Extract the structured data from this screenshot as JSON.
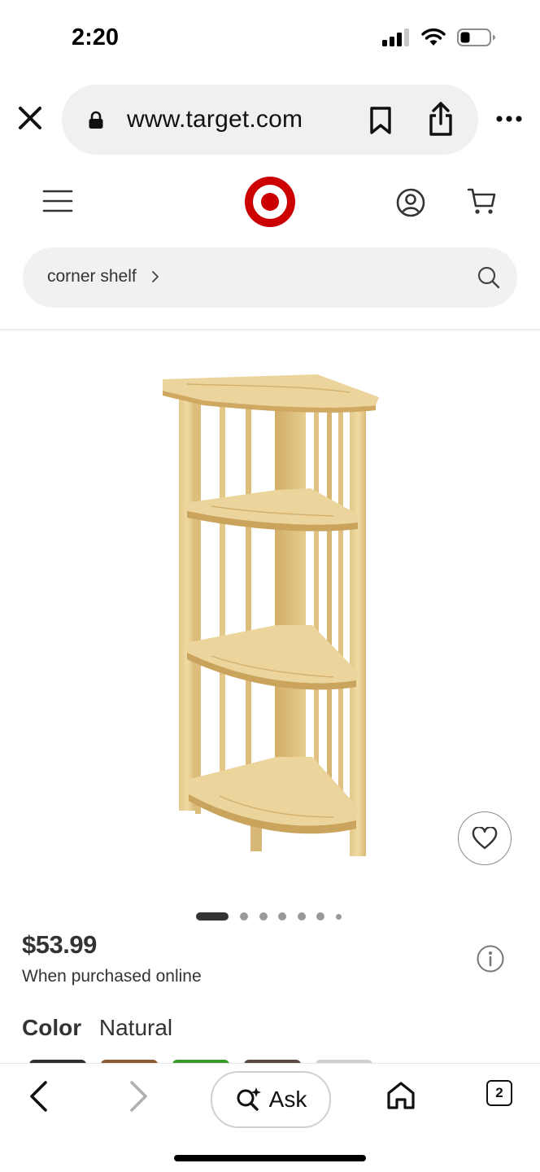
{
  "status": {
    "time": "2:20"
  },
  "browser": {
    "url": "www.target.com",
    "icons": [
      "close-icon",
      "lock-icon",
      "bookmark-icon",
      "share-icon",
      "more-icon"
    ]
  },
  "header": {
    "icons": [
      "menu-icon",
      "target-logo",
      "account-icon",
      "cart-icon"
    ],
    "brand_color": "#cc0000"
  },
  "search": {
    "query": "corner shelf"
  },
  "product": {
    "price": "$53.99",
    "price_note": "When purchased online",
    "color_label": "Color",
    "color_value": "Natural",
    "carousel": {
      "total": 7,
      "active_index": 0
    },
    "swatches": [
      "#2f2f2f",
      "#8a5a33",
      "#3a9a2a",
      "#5a4a46",
      "#cfcfcf"
    ]
  },
  "toolbar": {
    "ask_label": "Ask",
    "tab_count": "2",
    "icons": [
      "back-icon",
      "forward-icon",
      "ai-search-icon",
      "home-icon",
      "tabs-icon"
    ]
  }
}
